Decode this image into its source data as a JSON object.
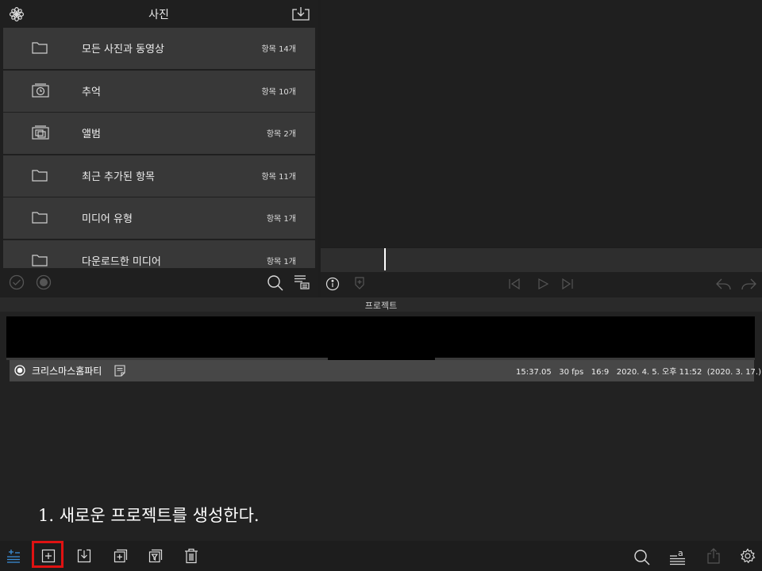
{
  "left_panel": {
    "title": "사진",
    "albums": [
      {
        "name": "모든 사진과 동영상",
        "count": "항목 14개",
        "icon": "folder-icon"
      },
      {
        "name": "추억",
        "count": "항목 10개",
        "icon": "memories-icon"
      },
      {
        "name": "앨범",
        "count": "항목 2개",
        "icon": "album-icon"
      },
      {
        "name": "최근 추가된 항목",
        "count": "항목 11개",
        "icon": "folder-icon"
      },
      {
        "name": "미디어 유형",
        "count": "항목 1개",
        "icon": "folder-icon"
      },
      {
        "name": "다운로드한 미디어",
        "count": "항목 1개",
        "icon": "folder-icon"
      }
    ]
  },
  "project_section": {
    "header": "프로젝트",
    "project": {
      "name": "크리스마스홈파티",
      "meta": "15:37.05   30 fps   16:9   2020. 4. 5. 오후 11:52  (2020. 3. 17.)"
    }
  },
  "instruction": "1. 새로운 프로젝트를 생성한다.",
  "colors": {
    "accent": "#3b8fd9",
    "highlight": "#e01212",
    "row_background": "#383838"
  }
}
